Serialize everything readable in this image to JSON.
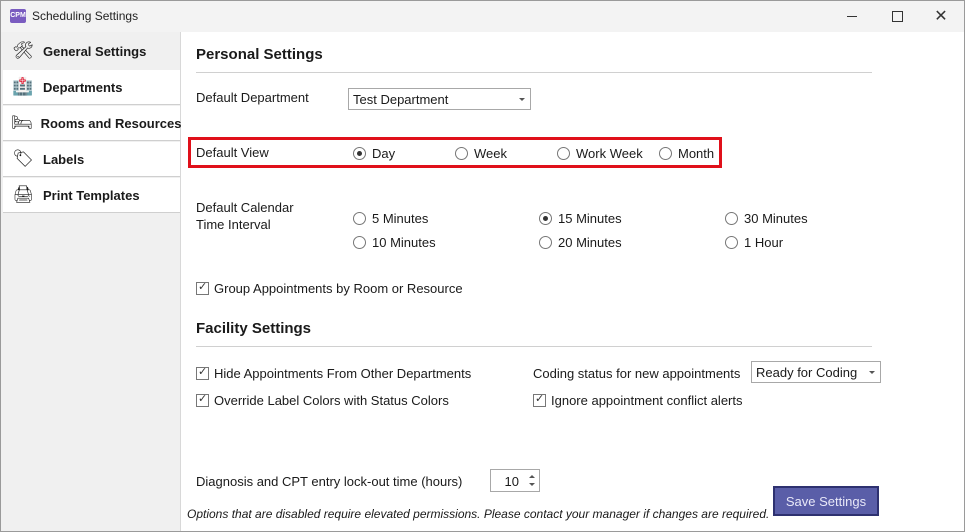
{
  "window": {
    "title": "Scheduling Settings",
    "app_icon_text": "CPM",
    "minimize_glyph": "minimize-icon",
    "maximize_glyph": "maximize-icon",
    "close_glyph": "✕"
  },
  "sidebar": {
    "items": [
      {
        "label": "General Settings",
        "icon": "tools-icon",
        "glyph": "🛠"
      },
      {
        "label": "Departments",
        "icon": "building-icon",
        "glyph": "🏥"
      },
      {
        "label": "Rooms and Resources",
        "icon": "bed-icon",
        "glyph": "🛏"
      },
      {
        "label": "Labels",
        "icon": "tag-icon",
        "glyph": "🏷"
      },
      {
        "label": "Print Templates",
        "icon": "printer-icon",
        "glyph": "🖨"
      }
    ]
  },
  "personal": {
    "title": "Personal Settings",
    "default_department_label": "Default Department",
    "default_department_value": "Test Department",
    "default_view_label": "Default View",
    "default_view_options": [
      "Day",
      "Week",
      "Work Week",
      "Month"
    ],
    "default_view_selected": "Day",
    "interval_label_line1": "Default Calendar",
    "interval_label_line2": "Time Interval",
    "interval_options": [
      "5 Minutes",
      "15 Minutes",
      "30 Minutes",
      "10 Minutes",
      "20 Minutes",
      "1 Hour"
    ],
    "interval_selected": "15 Minutes",
    "group_by_room_label": "Group Appointments by Room or Resource",
    "group_by_room_checked": true
  },
  "facility": {
    "title": "Facility Settings",
    "hide_other_depts_label": "Hide Appointments From Other Departments",
    "hide_other_depts_checked": true,
    "override_label_colors_label": "Override Label Colors with Status Colors",
    "override_label_colors_checked": true,
    "coding_status_label": "Coding status for new appointments",
    "coding_status_value": "Ready for Coding",
    "ignore_conflicts_label": "Ignore appointment conflict alerts",
    "ignore_conflicts_checked": true
  },
  "lockout": {
    "label": "Diagnosis and CPT entry lock-out time (hours)",
    "value": "10"
  },
  "footer": {
    "save_label": "Save Settings",
    "note": "Options that are disabled require elevated permissions.  Please contact your manager if changes are required."
  },
  "colors": {
    "highlight": "#e0101a",
    "save_button": "#5a5ea8"
  }
}
